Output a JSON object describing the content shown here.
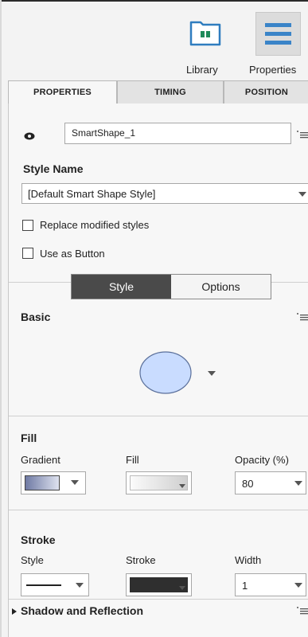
{
  "toolbar": {
    "library_label": "Library",
    "properties_label": "Properties"
  },
  "tabs": [
    {
      "label": "PROPERTIES",
      "active": true
    },
    {
      "label": "TIMING",
      "active": false
    },
    {
      "label": "POSITION",
      "active": false
    }
  ],
  "properties": {
    "object_name": "SmartShape_1",
    "style_name_label": "Style Name",
    "style_name_value": "[Default Smart Shape Style]",
    "replace_modified_label": "Replace modified styles",
    "replace_modified_checked": false,
    "use_as_button_label": "Use as Button",
    "use_as_button_checked": false,
    "segment": {
      "style_label": "Style",
      "options_label": "Options",
      "selected": "Style"
    },
    "basic": {
      "title": "Basic",
      "shape": "ellipse",
      "shape_fill": "#c9dcff"
    },
    "fill": {
      "title": "Fill",
      "gradient_label": "Gradient",
      "fill_label": "Fill",
      "opacity_label": "Opacity (%)",
      "opacity_value": "80"
    },
    "stroke": {
      "title": "Stroke",
      "style_label": "Style",
      "stroke_label": "Stroke",
      "width_label": "Width",
      "width_value": "1",
      "stroke_color": "#2f2f2f"
    },
    "shadow_title": "Shadow and Reflection"
  },
  "colors": {
    "accent": "#3a84c8",
    "active_segment": "#4a4a4a",
    "folder_icon": "#2f7dbf"
  },
  "icons": [
    "library-folder-icon",
    "properties-menu-icon",
    "eye-icon",
    "panel-menu-icon",
    "dropdown-caret-icon"
  ]
}
